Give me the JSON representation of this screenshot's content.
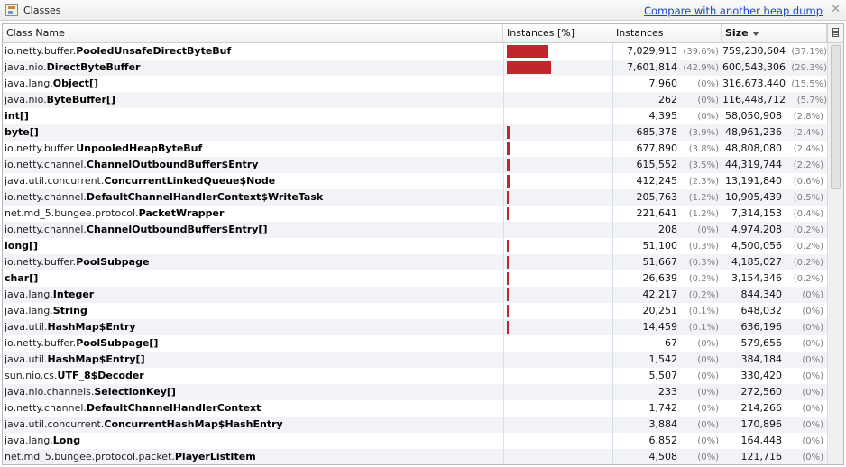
{
  "window": {
    "title": "Classes",
    "compare_link": "Compare with another heap dump",
    "close_label": "✕"
  },
  "table": {
    "headers": {
      "name": "Class Name",
      "bar": "Instances [%]",
      "instances": "Instances",
      "size": "Size"
    },
    "sorted_column": "size",
    "bar_color": "#c0272d",
    "rows": [
      {
        "pkg": "io.netty.buffer.",
        "cls": "PooledUnsafeDirectByteBuf",
        "instances": "7,029,913",
        "inst_pct": "(39.6%)",
        "size": "759,230,604",
        "size_pct": "(37.1%)",
        "bar_fraction": 0.396
      },
      {
        "pkg": "java.nio.",
        "cls": "DirectByteBuffer",
        "instances": "7,601,814",
        "inst_pct": "(42.9%)",
        "size": "600,543,306",
        "size_pct": "(29.3%)",
        "bar_fraction": 0.429
      },
      {
        "pkg": "java.lang.",
        "cls": "Object[]",
        "instances": "7,960",
        "inst_pct": "(0%)",
        "size": "316,673,440",
        "size_pct": "(15.5%)",
        "bar_fraction": 0.0
      },
      {
        "pkg": "java.nio.",
        "cls": "ByteBuffer[]",
        "instances": "262",
        "inst_pct": "(0%)",
        "size": "116,448,712",
        "size_pct": "(5.7%)",
        "bar_fraction": 0.0
      },
      {
        "pkg": "",
        "cls": "int[]",
        "instances": "4,395",
        "inst_pct": "(0%)",
        "size": "58,050,908",
        "size_pct": "(2.8%)",
        "bar_fraction": 0.0
      },
      {
        "pkg": "",
        "cls": "byte[]",
        "instances": "685,378",
        "inst_pct": "(3.9%)",
        "size": "48,961,236",
        "size_pct": "(2.4%)",
        "bar_fraction": 0.039
      },
      {
        "pkg": "io.netty.buffer.",
        "cls": "UnpooledHeapByteBuf",
        "instances": "677,890",
        "inst_pct": "(3.8%)",
        "size": "48,808,080",
        "size_pct": "(2.4%)",
        "bar_fraction": 0.038
      },
      {
        "pkg": "io.netty.channel.",
        "cls": "ChannelOutboundBuffer$Entry",
        "instances": "615,552",
        "inst_pct": "(3.5%)",
        "size": "44,319,744",
        "size_pct": "(2.2%)",
        "bar_fraction": 0.035
      },
      {
        "pkg": "java.util.concurrent.",
        "cls": "ConcurrentLinkedQueue$Node",
        "instances": "412,245",
        "inst_pct": "(2.3%)",
        "size": "13,191,840",
        "size_pct": "(0.6%)",
        "bar_fraction": 0.023
      },
      {
        "pkg": "io.netty.channel.",
        "cls": "DefaultChannelHandlerContext$WriteTask",
        "instances": "205,763",
        "inst_pct": "(1.2%)",
        "size": "10,905,439",
        "size_pct": "(0.5%)",
        "bar_fraction": 0.012
      },
      {
        "pkg": "net.md_5.bungee.protocol.",
        "cls": "PacketWrapper",
        "instances": "221,641",
        "inst_pct": "(1.2%)",
        "size": "7,314,153",
        "size_pct": "(0.4%)",
        "bar_fraction": 0.012
      },
      {
        "pkg": "io.netty.channel.",
        "cls": "ChannelOutboundBuffer$Entry[]",
        "instances": "208",
        "inst_pct": "(0%)",
        "size": "4,974,208",
        "size_pct": "(0.2%)",
        "bar_fraction": 0.0
      },
      {
        "pkg": "",
        "cls": "long[]",
        "instances": "51,100",
        "inst_pct": "(0.3%)",
        "size": "4,500,056",
        "size_pct": "(0.2%)",
        "bar_fraction": 0.003
      },
      {
        "pkg": "io.netty.buffer.",
        "cls": "PoolSubpage",
        "instances": "51,667",
        "inst_pct": "(0.3%)",
        "size": "4,185,027",
        "size_pct": "(0.2%)",
        "bar_fraction": 0.003
      },
      {
        "pkg": "",
        "cls": "char[]",
        "instances": "26,639",
        "inst_pct": "(0.2%)",
        "size": "3,154,346",
        "size_pct": "(0.2%)",
        "bar_fraction": 0.002
      },
      {
        "pkg": "java.lang.",
        "cls": "Integer",
        "instances": "42,217",
        "inst_pct": "(0.2%)",
        "size": "844,340",
        "size_pct": "(0%)",
        "bar_fraction": 0.002
      },
      {
        "pkg": "java.lang.",
        "cls": "String",
        "instances": "20,251",
        "inst_pct": "(0.1%)",
        "size": "648,032",
        "size_pct": "(0%)",
        "bar_fraction": 0.001
      },
      {
        "pkg": "java.util.",
        "cls": "HashMap$Entry",
        "instances": "14,459",
        "inst_pct": "(0.1%)",
        "size": "636,196",
        "size_pct": "(0%)",
        "bar_fraction": 0.001
      },
      {
        "pkg": "io.netty.buffer.",
        "cls": "PoolSubpage[]",
        "instances": "67",
        "inst_pct": "(0%)",
        "size": "579,656",
        "size_pct": "(0%)",
        "bar_fraction": 0.0
      },
      {
        "pkg": "java.util.",
        "cls": "HashMap$Entry[]",
        "instances": "1,542",
        "inst_pct": "(0%)",
        "size": "384,184",
        "size_pct": "(0%)",
        "bar_fraction": 0.0
      },
      {
        "pkg": "sun.nio.cs.",
        "cls": "UTF_8$Decoder",
        "instances": "5,507",
        "inst_pct": "(0%)",
        "size": "330,420",
        "size_pct": "(0%)",
        "bar_fraction": 0.0
      },
      {
        "pkg": "java.nio.channels.",
        "cls": "SelectionKey[]",
        "instances": "233",
        "inst_pct": "(0%)",
        "size": "272,560",
        "size_pct": "(0%)",
        "bar_fraction": 0.0
      },
      {
        "pkg": "io.netty.channel.",
        "cls": "DefaultChannelHandlerContext",
        "instances": "1,742",
        "inst_pct": "(0%)",
        "size": "214,266",
        "size_pct": "(0%)",
        "bar_fraction": 0.0
      },
      {
        "pkg": "java.util.concurrent.",
        "cls": "ConcurrentHashMap$HashEntry",
        "instances": "3,884",
        "inst_pct": "(0%)",
        "size": "170,896",
        "size_pct": "(0%)",
        "bar_fraction": 0.0
      },
      {
        "pkg": "java.lang.",
        "cls": "Long",
        "instances": "6,852",
        "inst_pct": "(0%)",
        "size": "164,448",
        "size_pct": "(0%)",
        "bar_fraction": 0.0
      },
      {
        "pkg": "net.md_5.bungee.protocol.packet.",
        "cls": "PlayerListItem",
        "instances": "4,508",
        "inst_pct": "(0%)",
        "size": "121,716",
        "size_pct": "(0%)",
        "bar_fraction": 0.0
      }
    ]
  }
}
